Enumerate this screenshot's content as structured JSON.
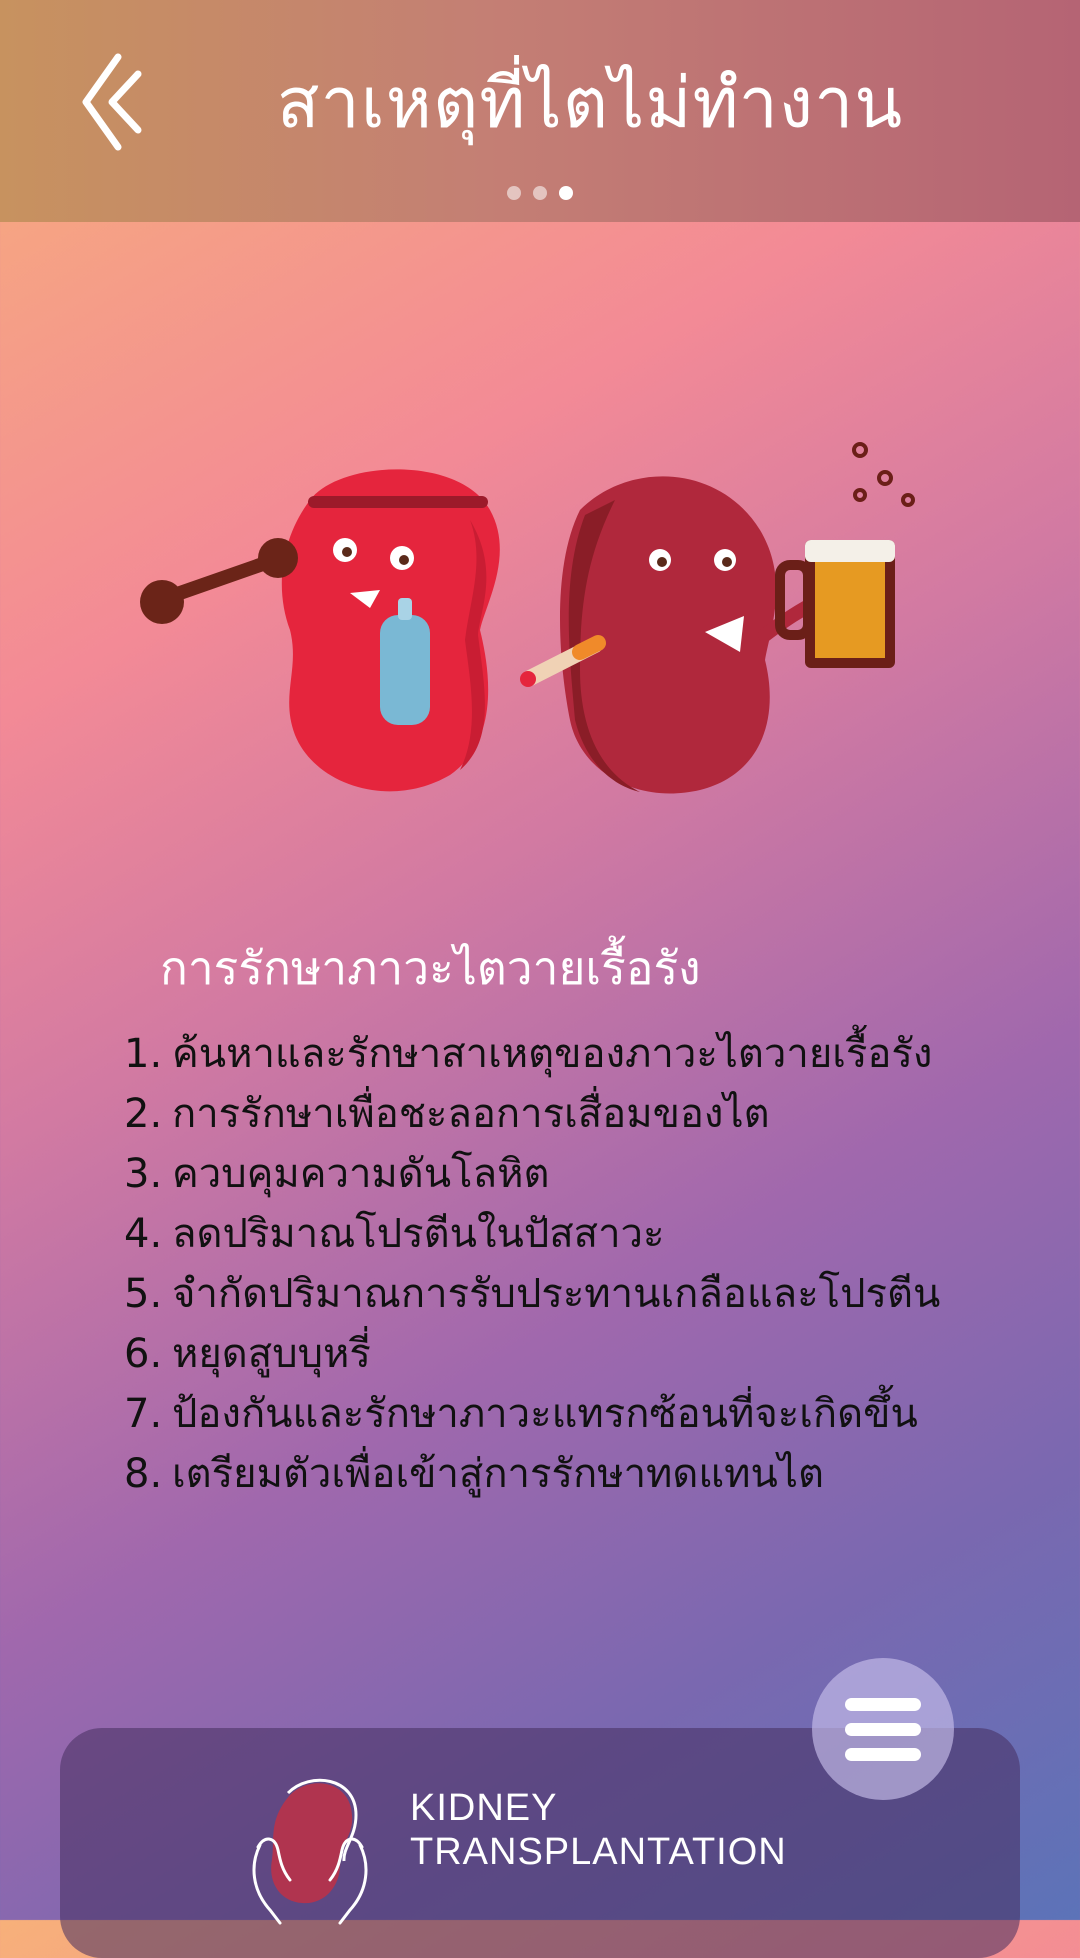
{
  "header": {
    "title": "สาเหตุที่ไตไม่ทำงาน",
    "back_icon": "double-chevron-left-icon",
    "page_dots": {
      "count": 3,
      "active_index": 2
    }
  },
  "illustration": {
    "description_icon": "kidney-characters-illustration"
  },
  "main": {
    "section_title": "การรักษาภาวะไตวายเรื้อรัง",
    "steps": [
      {
        "num": "1.",
        "text": "ค้นหาและรักษาสาเหตุของภาวะไตวายเรื้อรัง"
      },
      {
        "num": "2.",
        "text": "การรักษาเพื่อชะลอการเสื่อมของไต"
      },
      {
        "num": "3.",
        "text": "ควบคุมความดันโลหิต"
      },
      {
        "num": "4.",
        "text": "ลดปริมาณโปรตีนในปัสสาวะ"
      },
      {
        "num": "5.",
        "text": "จำกัดปริมาณการรับประทานเกลือและโปรตีน"
      },
      {
        "num": "6.",
        "text": "หยุดสูบบุหรี่"
      },
      {
        "num": "7.",
        "text": "ป้องกันและรักษาภาวะแทรกซ้อนที่จะเกิดขึ้น"
      },
      {
        "num": "8.",
        "text": "เตรียมตัวเพื่อเข้าสู่การรักษาทดแทนไต"
      }
    ]
  },
  "bottom_bar": {
    "brand_line1": "KIDNEY",
    "brand_line2": "TRANSPLANTATION",
    "menu_icon": "hamburger-menu-icon"
  }
}
